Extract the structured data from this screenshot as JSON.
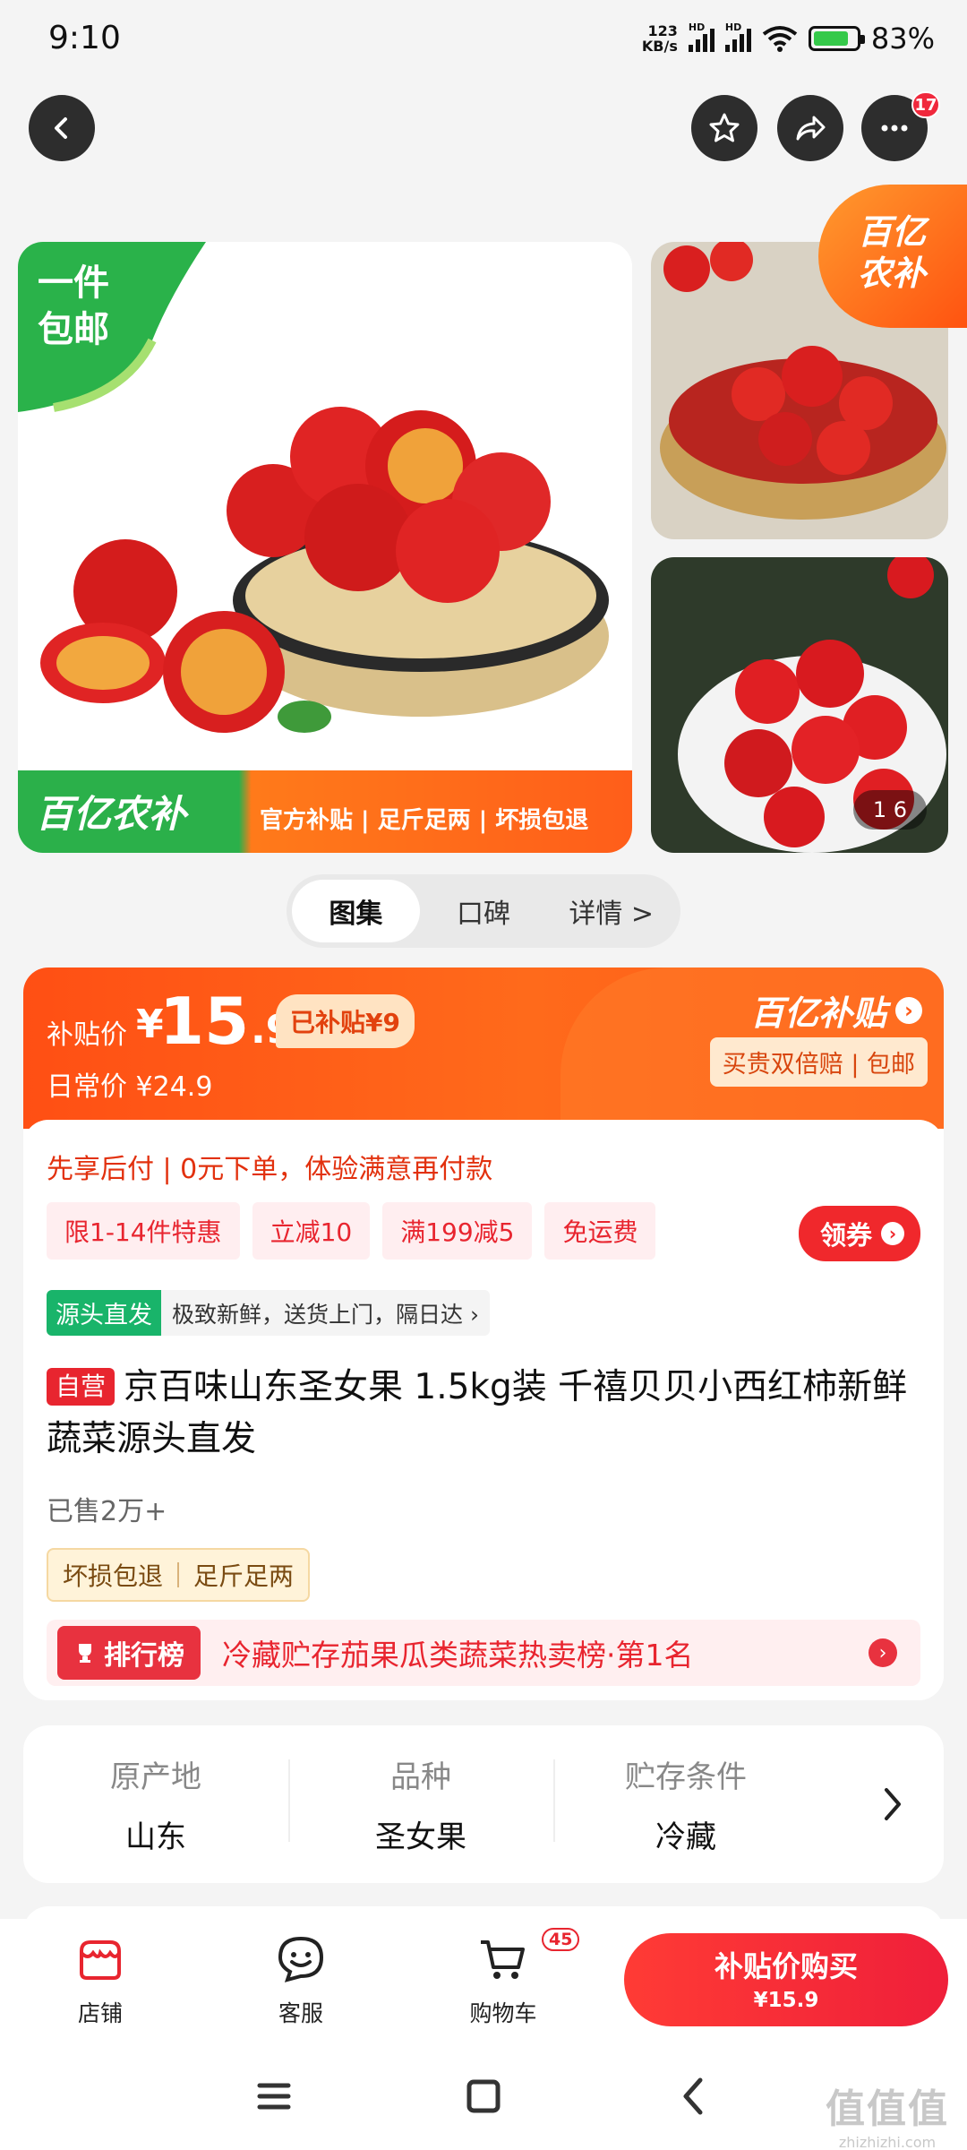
{
  "status_bar": {
    "time": "9:10",
    "net_speed_value": "123",
    "net_speed_unit": "KB/s",
    "hd_label": "HD",
    "battery_pct": "83%"
  },
  "top_actions": {
    "more_badge": "17"
  },
  "gallery": {
    "ribbon_line1": "一件",
    "ribbon_line2": "包邮",
    "band_logo": "百亿农补",
    "band_tags": "官方补贴 | 足斤足两 | 坏损包退",
    "corner_badge_line1": "百亿",
    "corner_badge_line2": "农补",
    "counter": "1  6"
  },
  "tabs": [
    {
      "label": "图集"
    },
    {
      "label": "口碑"
    },
    {
      "label": "详情 >"
    }
  ],
  "price": {
    "label": "补贴价",
    "yen": "¥",
    "integer": "15",
    "decimal": ".9",
    "subsidy_pill": "已补贴¥9",
    "regular": "日常价 ¥24.9",
    "brand": "百亿补贴",
    "guarantee": "买贵双倍赔 | 包邮"
  },
  "promo": {
    "pay_later": "先享后付 | 0元下单，体验满意再付款",
    "coupons": [
      "限1-14件特惠",
      "立减10",
      "满199减5",
      "免运费"
    ],
    "get_coupon": "领券",
    "origin_tag": "源头直发",
    "origin_desc": "极致新鲜，送货上门，隔日达 ›"
  },
  "product": {
    "self_operated": "自营",
    "title": "京百味山东圣女果 1.5kg装 千禧贝贝小西红柿新鲜蔬菜源头直发",
    "sold": "已售2万+",
    "service_tags": [
      "坏损包退",
      "足斤足两"
    ],
    "rank_badge": "排行榜",
    "rank_text": "冷藏贮存茄果瓜类蔬菜热卖榜·第1名"
  },
  "attributes": [
    {
      "key": "原产地",
      "value": "山东"
    },
    {
      "key": "品种",
      "value": "圣女果"
    },
    {
      "key": "贮存条件",
      "value": "冷藏"
    }
  ],
  "action_bar": {
    "store": "店铺",
    "service": "客服",
    "cart": "购物车",
    "cart_badge": "45",
    "buy_line1": "补贴价购买",
    "buy_line2": "¥15.9"
  },
  "watermark": {
    "big": "值值值",
    "small": "zhizhizhi.com"
  },
  "colors": {
    "accent_red": "#e8252f",
    "price_orange": "#ff5a17",
    "green": "#2bb04a"
  }
}
